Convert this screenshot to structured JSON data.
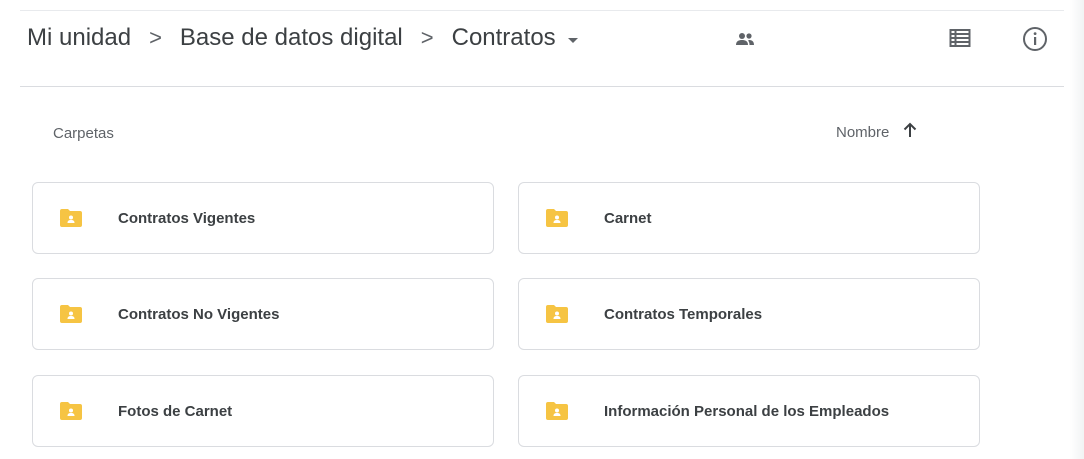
{
  "breadcrumb": {
    "items": [
      "Mi unidad",
      "Base de datos digital",
      "Contratos"
    ],
    "separator": ">"
  },
  "icons": {
    "shared": "people-icon",
    "list_view": "list-view-icon",
    "info": "info-icon",
    "folder": "shared-folder-icon",
    "sort": "arrow-up-icon",
    "dropdown": "caret-down-icon"
  },
  "section": {
    "label": "Carpetas"
  },
  "sort": {
    "label": "Nombre",
    "direction": "ascending"
  },
  "folders": [
    {
      "name": "Contratos Vigentes"
    },
    {
      "name": "Carnet"
    },
    {
      "name": "Contratos No Vigentes"
    },
    {
      "name": "Contratos Temporales"
    },
    {
      "name": "Fotos de Carnet"
    },
    {
      "name": "Información Personal de los Empleados"
    }
  ],
  "colors": {
    "folder": "#f6c443",
    "text": "#3c4043",
    "secondary": "#5f6368",
    "border": "#dadce0"
  }
}
